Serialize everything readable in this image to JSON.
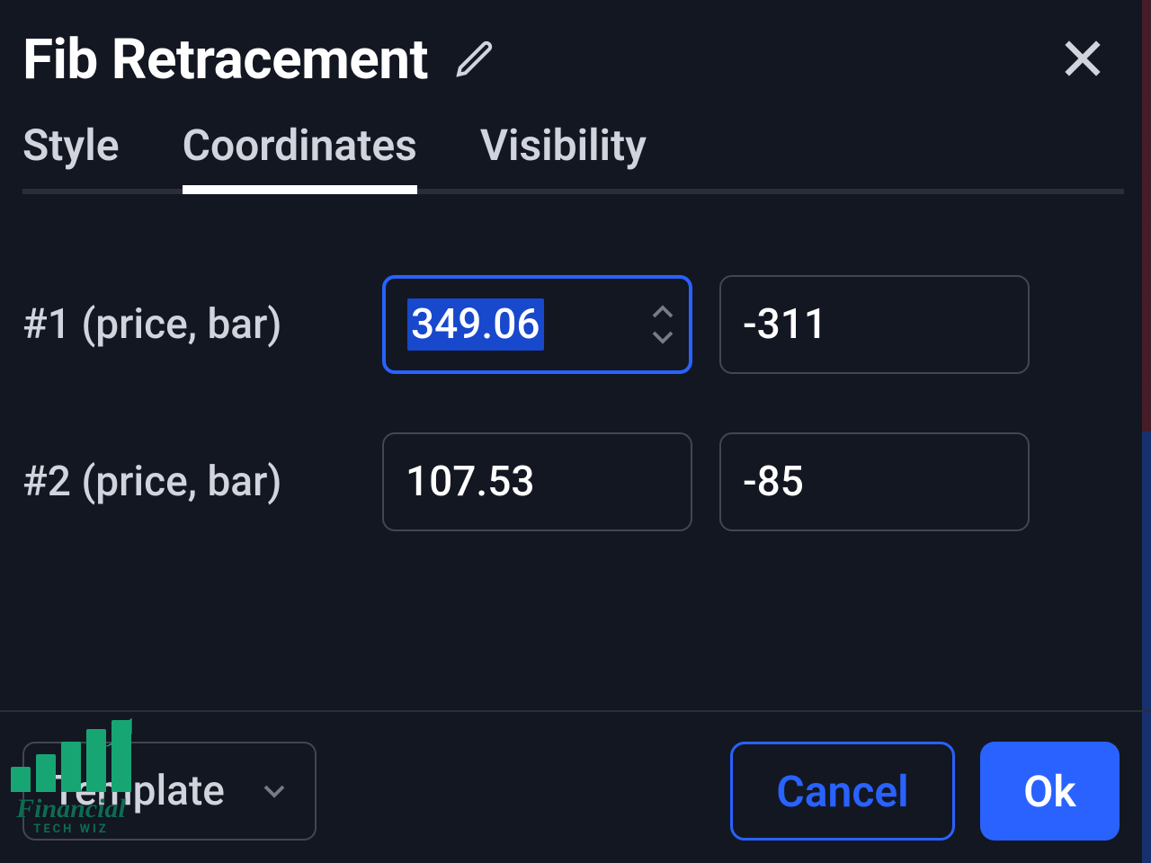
{
  "header": {
    "title": "Fib Retracement"
  },
  "tabs": {
    "style": "Style",
    "coordinates": "Coordinates",
    "visibility": "Visibility",
    "active": "coordinates"
  },
  "rows": [
    {
      "label": "#1 (price, bar)",
      "price": "349.06",
      "bar": "-311",
      "focused": true
    },
    {
      "label": "#2 (price, bar)",
      "price": "107.53",
      "bar": "-85",
      "focused": false
    }
  ],
  "footer": {
    "template": "Template",
    "cancel": "Cancel",
    "ok": "Ok"
  },
  "watermark": {
    "line1": "Financial",
    "line2": "TECH WIZ"
  },
  "colors": {
    "accent": "#2962ff",
    "bg": "#131722",
    "border": "#434651"
  }
}
